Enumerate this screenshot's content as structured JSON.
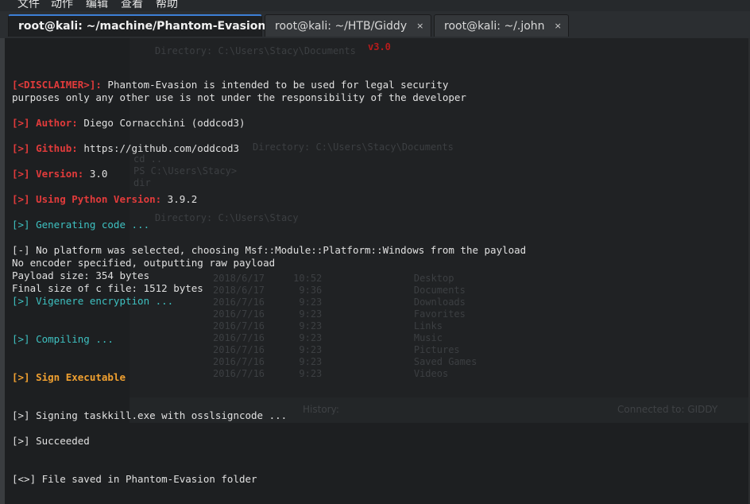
{
  "menubar": {
    "items": [
      "文件",
      "动作",
      "编辑",
      "查看",
      "帮助"
    ]
  },
  "tabs": [
    {
      "label": "root@kali: ~/machine/Phantom-Evasion",
      "close": "×",
      "active": true
    },
    {
      "label": "root@kali: ~/HTB/Giddy",
      "close": "×",
      "active": false
    },
    {
      "label": "root@kali: ~/.john",
      "close": "×",
      "active": false
    }
  ],
  "background": {
    "ghost_lines": [
      "Directory: C:\\Users\\Stacy\\Documents",
      "cd ..",
      "PS C:\\Users\\Stacy>",
      "dir",
      "Directory: C:\\Users\\Stacy",
      "2018/6/17     10:52                Desktop",
      "2018/6/17      9:36                Documents",
      "2016/7/16      9:23                Downloads",
      "2016/7/16      9:23                Favorites",
      "2016/7/16      9:23                Links",
      "2016/7/16      9:23                Music",
      "2016/7/16      9:23                Pictures",
      "2016/7/16      9:23                Saved Games",
      "2016/7/16      9:23                Videos"
    ],
    "version": "v3.0",
    "bar_history": "History:",
    "bar_connected": "Connected to: GIDDY"
  },
  "terminal": {
    "disclaimer_tag": "[<DISCLAIMER>]:",
    "disclaimer_text": " Phantom-Evasion is intended to be used for legal security",
    "disclaimer_text2": "purposes only any other use is not under the responsibility of the developer",
    "author_tag": "[>] Author:",
    "author_val": " Diego Cornacchini (oddcod3)",
    "github_tag": "[>] Github:",
    "github_val": " https://github.com/oddcod3",
    "version_tag": "[>] Version:",
    "version_val": " 3.0",
    "python_tag": "[>] Using Python Version:",
    "python_val": " 3.9.2",
    "gen_prefix": "[>]",
    "gen_text": " Generating code ...",
    "noplat": "[-] No platform was selected, choosing Msf::Module::Platform::Windows from the payload",
    "noenc": "No encoder specified, outputting raw payload",
    "payload_size": "Payload size: 354 bytes",
    "final_size": "Final size of c file: 1512 bytes",
    "vig_prefix": "[>]",
    "vig_text": " Vigenere encryption ...",
    "comp_prefix": "[>]",
    "comp_text": " Compiling ...",
    "sign_exec": "[>] Sign Executable",
    "signing": "[>] Signing taskkill.exe with osslsigncode ...",
    "succeeded": "[>] Succeeded",
    "saved": "[<>] File saved in Phantom-Evasion folder"
  }
}
